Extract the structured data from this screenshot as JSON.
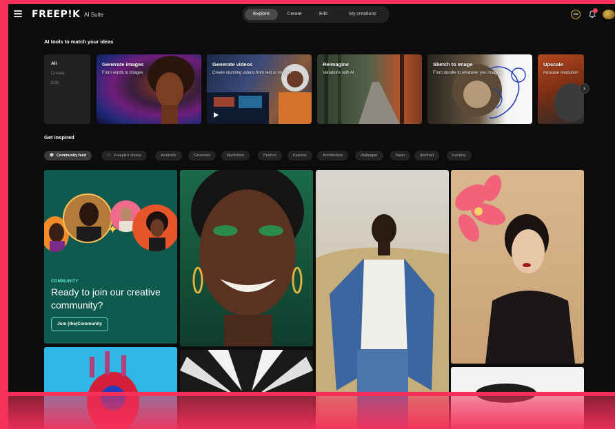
{
  "header": {
    "logo": "FREEP!K",
    "suite": "AI Suite",
    "nav": [
      {
        "label": "Explore",
        "active": true
      },
      {
        "label": "Create",
        "active": false
      },
      {
        "label": "Edit",
        "active": false
      },
      {
        "label": "My creations",
        "active": false
      }
    ],
    "credits_label": "70K"
  },
  "ai_tools": {
    "title": "AI tools to match your ideas",
    "modes": [
      "All",
      "Create",
      "Edit"
    ],
    "tools": [
      {
        "title": "Generate images",
        "desc": "From words to images"
      },
      {
        "title": "Generate videos",
        "desc": "Create stunning videos from text or images"
      },
      {
        "title": "Reimagine",
        "desc": "Variations with AI"
      },
      {
        "title": "Sketch to Image",
        "desc": "From doodle to whatever you imagine"
      },
      {
        "title": "Upscale",
        "desc": "Increase resolution"
      }
    ],
    "next_glyph": "›"
  },
  "inspired": {
    "title": "Get inspired",
    "filters": [
      "Community feed",
      "Freepik's choice",
      "Aesthetic",
      "Cinematic",
      "Illustration",
      "Product",
      "Fashion",
      "Architecture",
      "Wallpaper",
      "Neon",
      "Abstract",
      "Fantasy"
    ]
  },
  "community_card": {
    "label": "COMMUNITY",
    "title": "Ready to join our creative community?",
    "button": "Join (the)Community"
  },
  "colors": {
    "accent": "#f5305a",
    "community_bg": "#0e5a4e",
    "teal": "#5fe6c8"
  }
}
